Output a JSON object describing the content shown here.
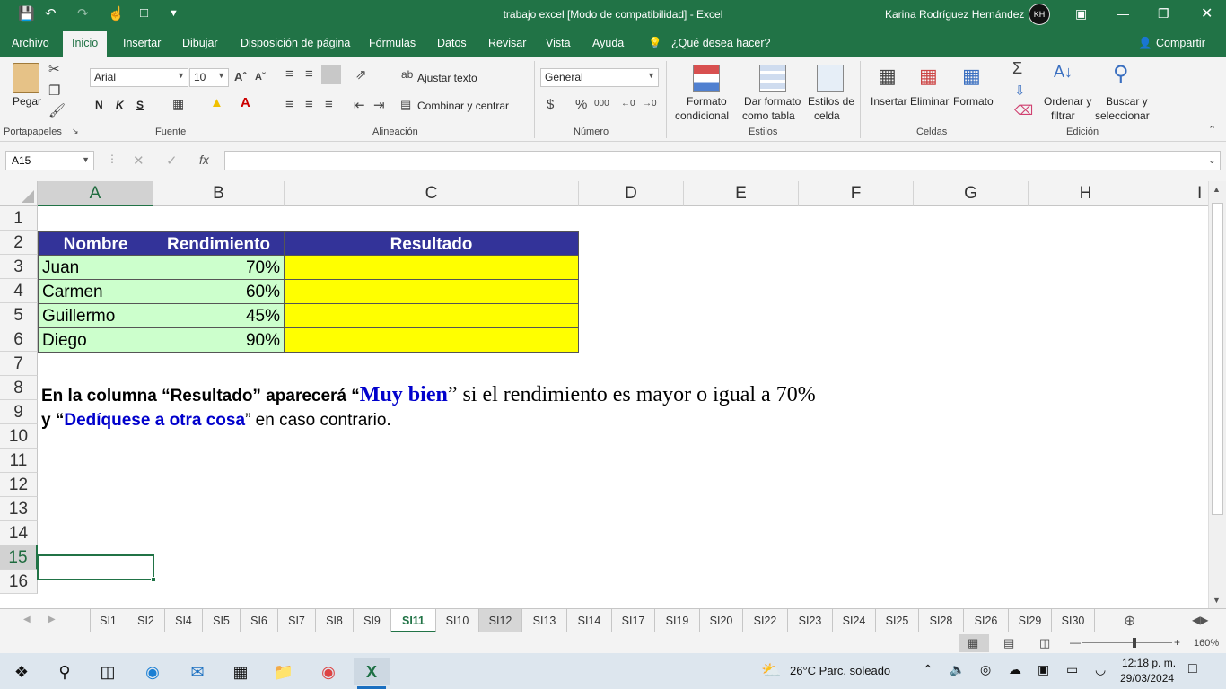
{
  "window": {
    "title": "trabajo excel  [Modo de compatibilidad]  -  Excel",
    "user": "Karina Rodríguez Hernández",
    "avatar_initials": "KH"
  },
  "menu_tabs": [
    "Archivo",
    "Inicio",
    "Insertar",
    "Dibujar",
    "Disposición de página",
    "Fórmulas",
    "Datos",
    "Revisar",
    "Vista",
    "Ayuda"
  ],
  "tell_me": "¿Qué desea hacer?",
  "share": "Compartir",
  "ribbon": {
    "paste": "Pegar",
    "font_name": "Arial",
    "font_size": "10",
    "bold": "N",
    "italic": "K",
    "underline": "S",
    "wrap_text": "Ajustar texto",
    "merge_center": "Combinar y centrar",
    "number_format": "General",
    "cond_format_1": "Formato",
    "cond_format_2": "condicional",
    "table_format_1": "Dar formato",
    "table_format_2": "como tabla",
    "cell_styles_1": "Estilos de",
    "cell_styles_2": "celda",
    "insert": "Insertar",
    "delete": "Eliminar",
    "format": "Formato",
    "sort_1": "Ordenar y",
    "sort_2": "filtrar",
    "find_1": "Buscar y",
    "find_2": "seleccionar",
    "groups": {
      "clipboard": "Portapapeles",
      "font": "Fuente",
      "alignment": "Alineación",
      "number": "Número",
      "styles": "Estilos",
      "cells": "Celdas",
      "editing": "Edición"
    }
  },
  "formula_bar": {
    "name_box": "A15",
    "formula": ""
  },
  "columns": [
    "A",
    "B",
    "C",
    "D",
    "E",
    "F",
    "G",
    "H",
    "I"
  ],
  "rows": [
    "1",
    "2",
    "3",
    "4",
    "5",
    "6",
    "7",
    "8",
    "9",
    "10",
    "11",
    "12",
    "13",
    "14",
    "15",
    "16"
  ],
  "table": {
    "headers": [
      "Nombre",
      "Rendimiento",
      "Resultado"
    ],
    "rows": [
      {
        "name": "Juan",
        "performance": "70%",
        "result": ""
      },
      {
        "name": "Carmen",
        "performance": "60%",
        "result": ""
      },
      {
        "name": "Guillermo",
        "performance": "45%",
        "result": ""
      },
      {
        "name": "Diego",
        "performance": "90%",
        "result": ""
      }
    ]
  },
  "instructions": {
    "line1_a": "En la columna “Resultado” aparecerá “",
    "line1_b": "Muy bien",
    "line1_c": "” si el rendimiento es mayor o igual a 70%",
    "line2_a": "y “",
    "line2_b": "Dedíquese a otra cosa",
    "line2_c": "” en caso contrario."
  },
  "sheets": [
    "SI1",
    "SI2",
    "SI4",
    "SI5",
    "SI6",
    "SI7",
    "SI8",
    "SI9",
    "SI11",
    "SI10",
    "SI12",
    "SI13",
    "SI14",
    "SI17",
    "SI19",
    "SI20",
    "SI22",
    "SI23",
    "SI24",
    "SI25",
    "SI28",
    "SI26",
    "SI29",
    "SI30"
  ],
  "active_sheet": "SI11",
  "zoom": "160%",
  "taskbar": {
    "weather": "26°C  Parc. soleado",
    "time": "12:18 p. m.",
    "date": "29/03/2024"
  },
  "colors": {
    "excel_green": "#217346",
    "header_fill": "#333399",
    "green_fill": "#ccffcc",
    "yellow_fill": "#ffff00",
    "highlight_blue": "#0000cc"
  }
}
